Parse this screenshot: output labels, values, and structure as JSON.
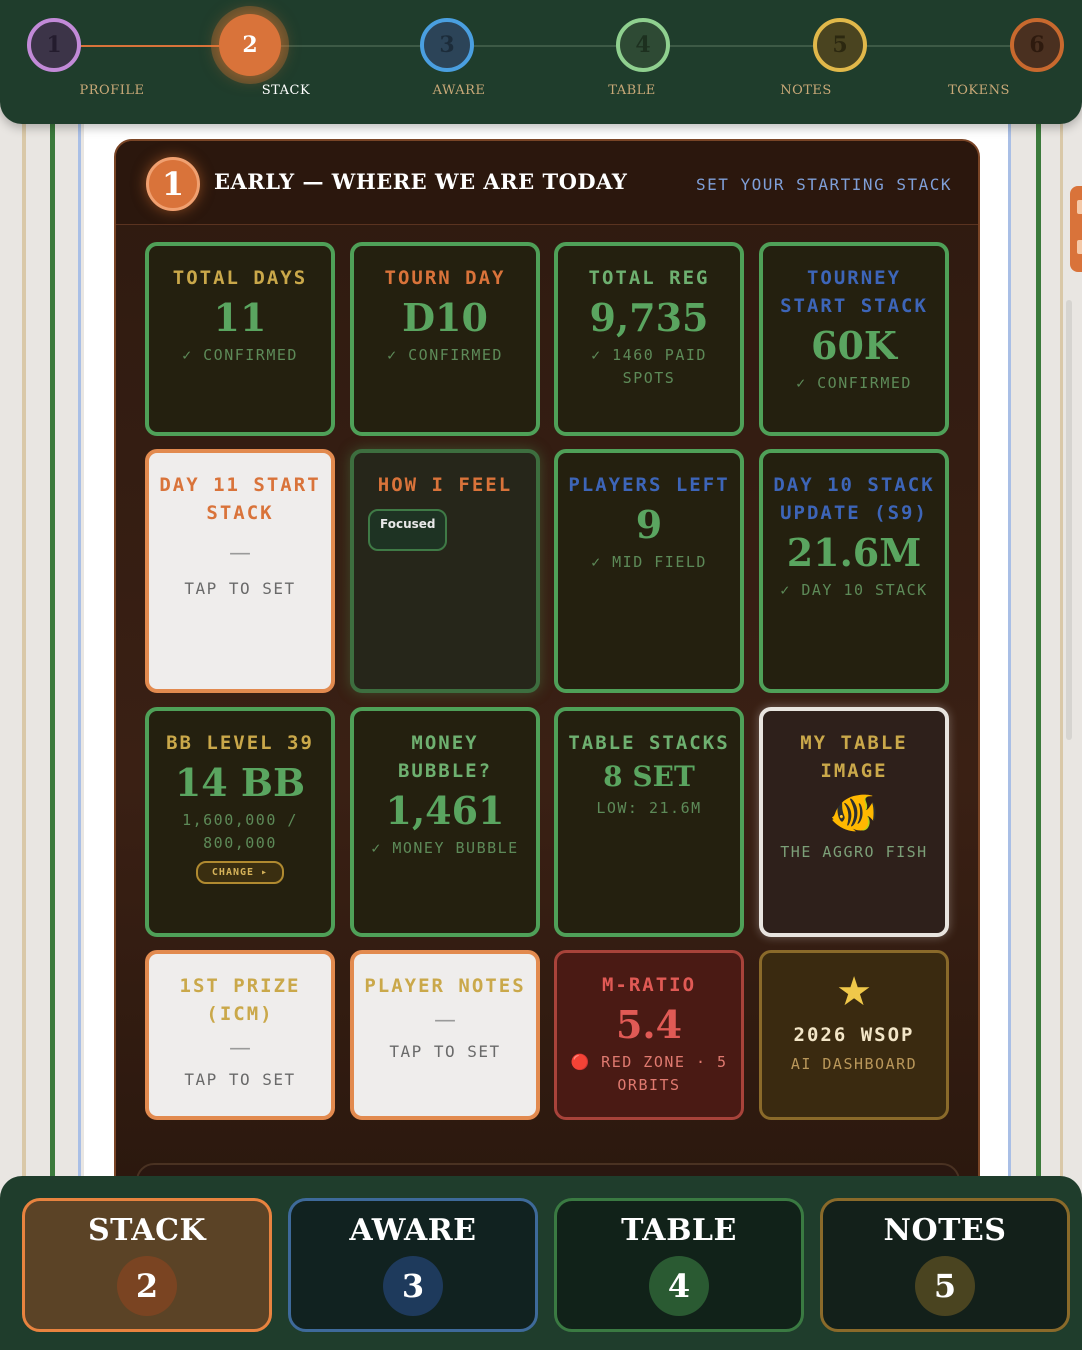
{
  "steps": [
    {
      "num": "1",
      "label": "PROFILE"
    },
    {
      "num": "2",
      "label": "STACK"
    },
    {
      "num": "3",
      "label": "AWARE"
    },
    {
      "num": "4",
      "label": "TABLE"
    },
    {
      "num": "5",
      "label": "NOTES"
    },
    {
      "num": "6",
      "label": "TOKENS"
    }
  ],
  "phase": {
    "number": "1",
    "title": "EARLY — WHERE WE ARE TODAY",
    "action": "SET YOUR STARTING STACK"
  },
  "cards": {
    "total_days": {
      "label": "TOTAL DAYS",
      "value": "11",
      "sub": "✓ CONFIRMED"
    },
    "tourn_day": {
      "label": "TOURN DAY",
      "value": "D10",
      "sub": "✓ CONFIRMED"
    },
    "total_reg": {
      "label": "TOTAL REG",
      "value": "9,735",
      "sub": "✓ 1460 PAID SPOTS"
    },
    "tourney_start_stack": {
      "label": "TOURNEY START STACK",
      "value": "60K",
      "sub": "✓ CONFIRMED"
    },
    "day11_start_stack": {
      "label": "DAY 11 START STACK",
      "dash": "—",
      "sub": "TAP TO SET"
    },
    "how_i_feel": {
      "label": "HOW I FEEL",
      "chip": "Focused"
    },
    "players_left": {
      "label": "PLAYERS LEFT",
      "value": "9",
      "sub": "✓ MID FIELD"
    },
    "day10_stack": {
      "label": "DAY 10 STACK UPDATE (S9)",
      "value": "21.6M",
      "sub": "✓ DAY 10 STACK"
    },
    "bb_level": {
      "label": "BB LEVEL 39",
      "value": "14 BB",
      "sub": "1,600,000 / 800,000",
      "button": "CHANGE ▸"
    },
    "money_bubble": {
      "label": "MONEY BUBBLE?",
      "value": "1,461",
      "sub": "✓ MONEY BUBBLE"
    },
    "table_stacks": {
      "label": "TABLE STACKS",
      "value": "8 SET",
      "sub": "LOW: 21.6M"
    },
    "table_image": {
      "label": "MY TABLE IMAGE",
      "emoji": "🐠",
      "sub": "THE AGGRO FISH"
    },
    "first_prize": {
      "label": "1ST PRIZE (ICM)",
      "dash": "—",
      "sub": "TAP TO SET"
    },
    "player_notes": {
      "label": "PLAYER NOTES",
      "dash": "—",
      "sub": "TAP TO SET"
    },
    "m_ratio": {
      "label": "M-RATIO",
      "value": "5.4",
      "sub": "🔴 RED ZONE · 5 ORBITS"
    },
    "wsop": {
      "star": "★",
      "label": "2026 WSOP",
      "sub": "AI DASHBOARD"
    }
  },
  "bottom_nav": [
    {
      "label": "STACK",
      "num": "2"
    },
    {
      "label": "AWARE",
      "num": "3"
    },
    {
      "label": "TABLE",
      "num": "4"
    },
    {
      "label": "NOTES",
      "num": "5"
    }
  ],
  "colors": {
    "profile": "#c28ad8",
    "stack": "#d9733a",
    "aware": "#4a9fe0",
    "table": "#8fd08f",
    "notes": "#e0b84a",
    "tokens": "#c8692e"
  }
}
